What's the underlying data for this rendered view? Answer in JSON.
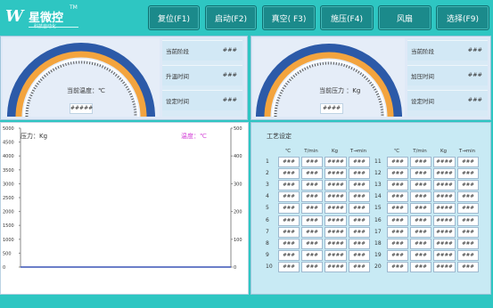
{
  "logo": {
    "mark": "W",
    "name": "星微控",
    "tm": "TM",
    "sub": "科技自动化"
  },
  "toolbar": {
    "reset": "复位(F1)",
    "start": "启动(F2)",
    "vacuum": "真空( F3)",
    "pressure": "施压(F4)",
    "fan": "风扇",
    "select": "选择(F9)"
  },
  "left_panel": {
    "stage_label": "当前阶段",
    "stage_value": "###",
    "time_label": "升温时间",
    "time_value": "###",
    "set_label": "设定时间",
    "set_value": "###",
    "gauge_label": "当前温度：℃",
    "gauge_value": "#####"
  },
  "right_panel": {
    "stage_label": "当前阶段",
    "stage_value": "###",
    "time_label": "加压时间",
    "time_value": "###",
    "set_label": "设定时间",
    "set_value": "###",
    "gauge_label": "当前压力 ：Kg",
    "gauge_value": "####"
  },
  "chart": {
    "left_label": "压力：Kg",
    "right_label": "温度：℃",
    "left_ticks": [
      "5000",
      "4500",
      "4000",
      "3500",
      "3000",
      "2500",
      "2000",
      "1500",
      "1000",
      "500",
      "0"
    ],
    "right_ticks": [
      "500",
      "400",
      "300",
      "200",
      "100",
      "0"
    ]
  },
  "chart_data": {
    "type": "line",
    "title": "",
    "y_left": {
      "label": "压力：Kg",
      "range": [
        0,
        5000
      ]
    },
    "y_right": {
      "label": "温度：℃",
      "range": [
        0,
        500
      ]
    },
    "series": []
  },
  "process": {
    "title": "工艺设定",
    "headers": [
      "℃",
      "T/min",
      "Kg",
      "T→min"
    ],
    "placeholders": [
      "###",
      "###",
      "####",
      "###"
    ],
    "rows_left": [
      "1",
      "2",
      "3",
      "4",
      "5",
      "6",
      "7",
      "8",
      "9",
      "10"
    ],
    "rows_right": [
      "11",
      "12",
      "13",
      "14",
      "15",
      "16",
      "17",
      "18",
      "19",
      "20"
    ]
  },
  "colors": {
    "accent": "#2ec6c2",
    "button": "#1b8a8b",
    "gauge_orange": "#f3a43e",
    "gauge_blue": "#2c5aa8",
    "pink": "#d23bd6"
  }
}
